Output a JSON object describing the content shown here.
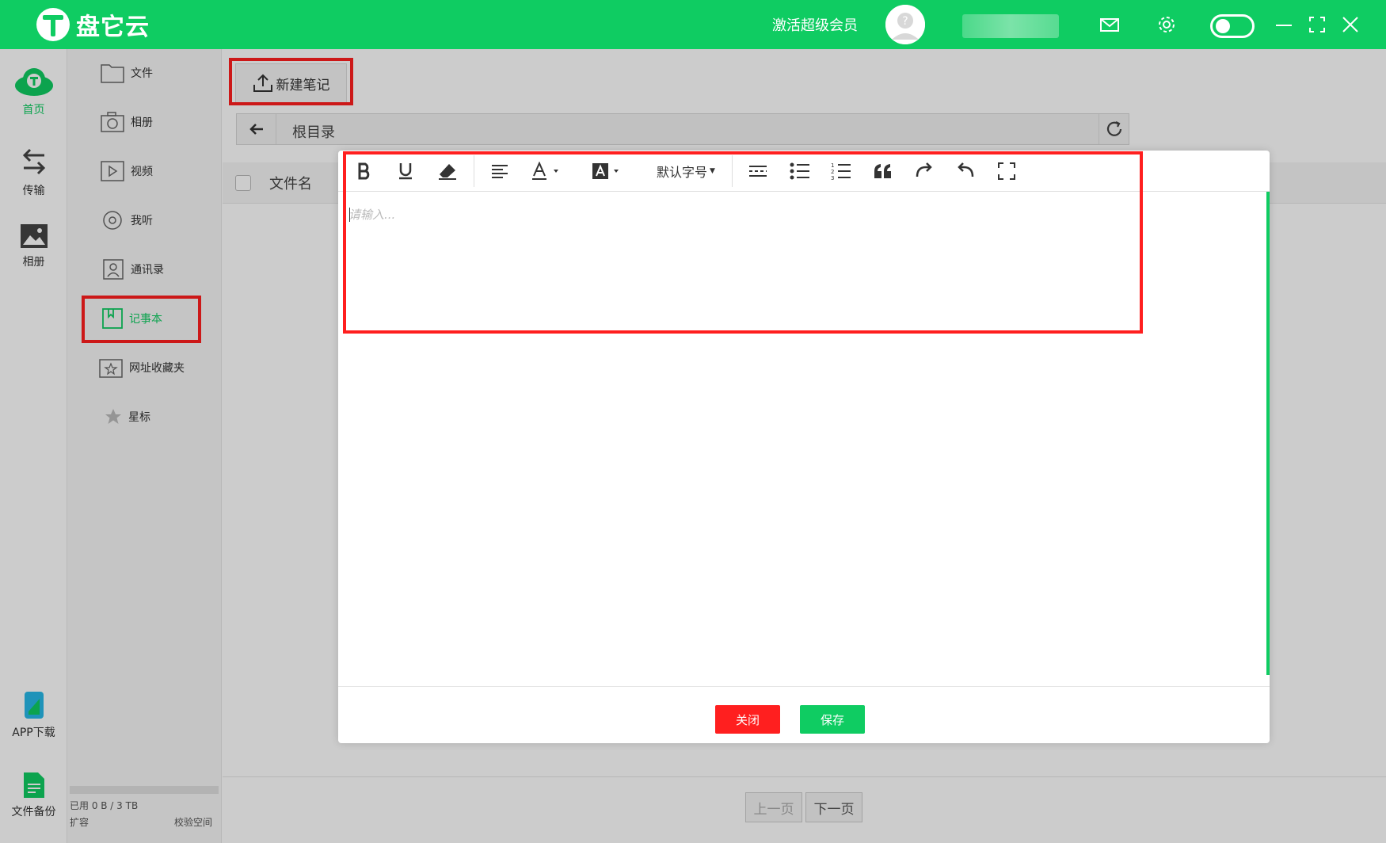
{
  "app": {
    "name": "盘它云"
  },
  "header": {
    "vip_label": "激活超级会员"
  },
  "rail": {
    "items": [
      {
        "label": "首页",
        "icon": "cloud-logo-icon"
      },
      {
        "label": "传输",
        "icon": "transfer-icon"
      },
      {
        "label": "相册",
        "icon": "image-icon"
      }
    ],
    "bottom": [
      {
        "label": "APP下载",
        "icon": "phone-icon"
      },
      {
        "label": "文件备份",
        "icon": "document-icon"
      }
    ]
  },
  "sidebar": {
    "items": [
      {
        "label": "文件",
        "icon": "folder-icon"
      },
      {
        "label": "相册",
        "icon": "camera-icon"
      },
      {
        "label": "视频",
        "icon": "video-icon"
      },
      {
        "label": "我听",
        "icon": "headphones-icon"
      },
      {
        "label": "通讯录",
        "icon": "contacts-icon"
      },
      {
        "label": "记事本",
        "icon": "notebook-icon"
      },
      {
        "label": "网址收藏夹",
        "icon": "bookmark-icon"
      },
      {
        "label": "星标",
        "icon": "star-icon"
      }
    ],
    "storage_used": "已用 0 B / 3 TB",
    "expand_label": "扩容",
    "verify_label": "校验空间"
  },
  "main": {
    "new_note_label": "新建笔记",
    "path": "根目录",
    "column_name": "文件名",
    "pager": {
      "prev": "上一页",
      "next": "下一页"
    }
  },
  "editor": {
    "placeholder": "请输入...",
    "font_size_label": "默认字号",
    "close_label": "关闭",
    "save_label": "保存"
  },
  "colors": {
    "brand": "#0fcc62",
    "highlight": "#ff1f1f",
    "close": "#ff1f1f",
    "save": "#0fcc62"
  }
}
